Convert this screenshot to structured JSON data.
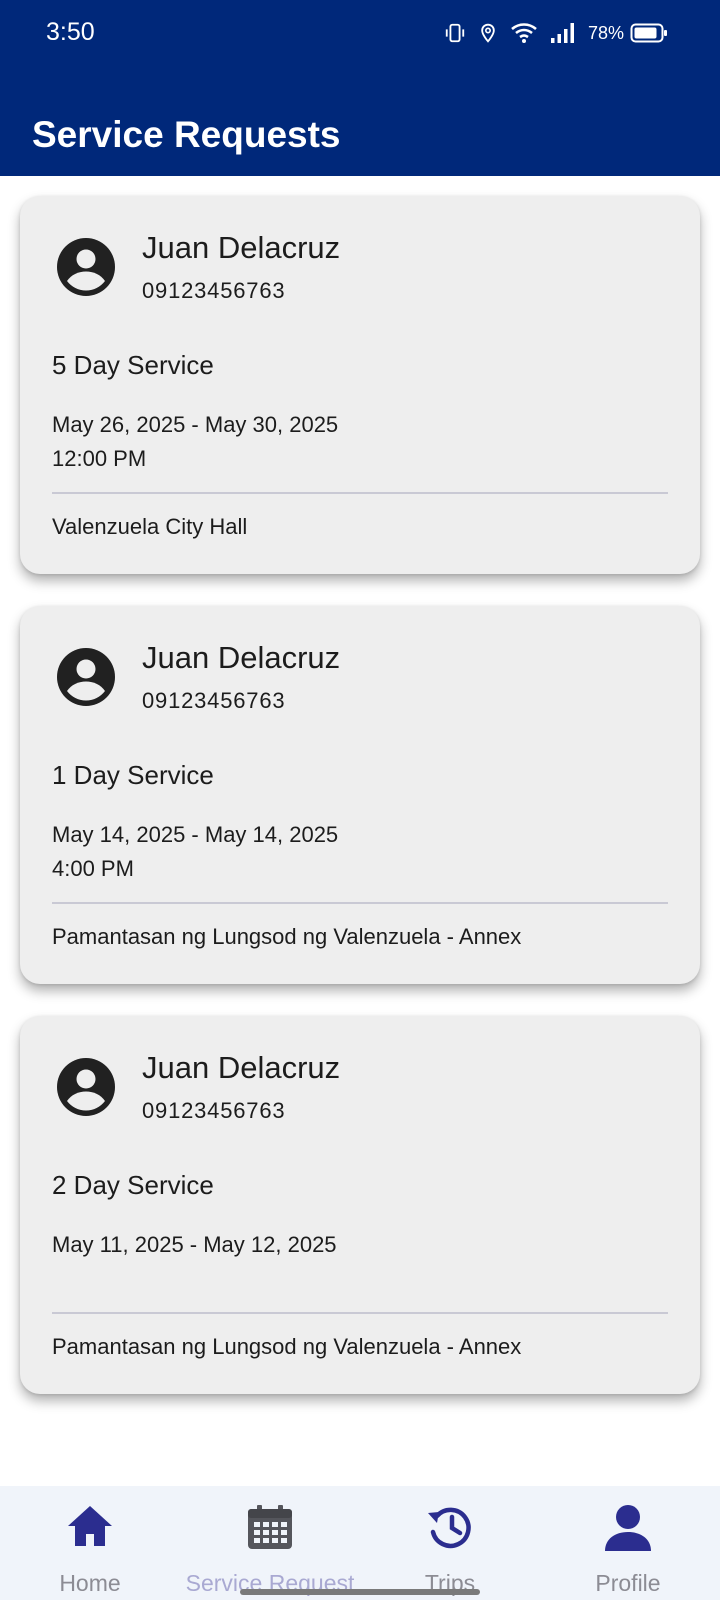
{
  "status_bar": {
    "time": "3:50",
    "battery": "78%"
  },
  "header": {
    "title": "Service Requests"
  },
  "requests": [
    {
      "name": "Juan Delacruz",
      "phone": "09123456763",
      "service": "5 Day Service",
      "dates": "May 26, 2025 - May 30, 2025",
      "time": "12:00 PM",
      "location": "Valenzuela City Hall"
    },
    {
      "name": "Juan Delacruz",
      "phone": "09123456763",
      "service": "1 Day Service",
      "dates": "May 14, 2025 - May 14, 2025",
      "time": "4:00 PM",
      "location": "Pamantasan ng Lungsod ng Valenzuela - Annex"
    },
    {
      "name": "Juan Delacruz",
      "phone": "09123456763",
      "service": "2 Day Service",
      "dates": "May 11, 2025 - May 12, 2025",
      "time": "",
      "location": "Pamantasan ng Lungsod ng Valenzuela - Annex"
    }
  ],
  "bottom_nav": {
    "items": [
      {
        "label": "Home",
        "icon": "home-icon"
      },
      {
        "label": "Service Request",
        "icon": "calendar-icon"
      },
      {
        "label": "Trips",
        "icon": "history-icon"
      },
      {
        "label": "Profile",
        "icon": "person-icon"
      }
    ],
    "active": "Service Request"
  },
  "colors": {
    "header_bg": "#00287a",
    "card_bg": "#eeeeee",
    "nav_icon": "#2b2d8f",
    "nav_active_label": "#a9a9d2",
    "nav_label": "#8c8c94"
  }
}
